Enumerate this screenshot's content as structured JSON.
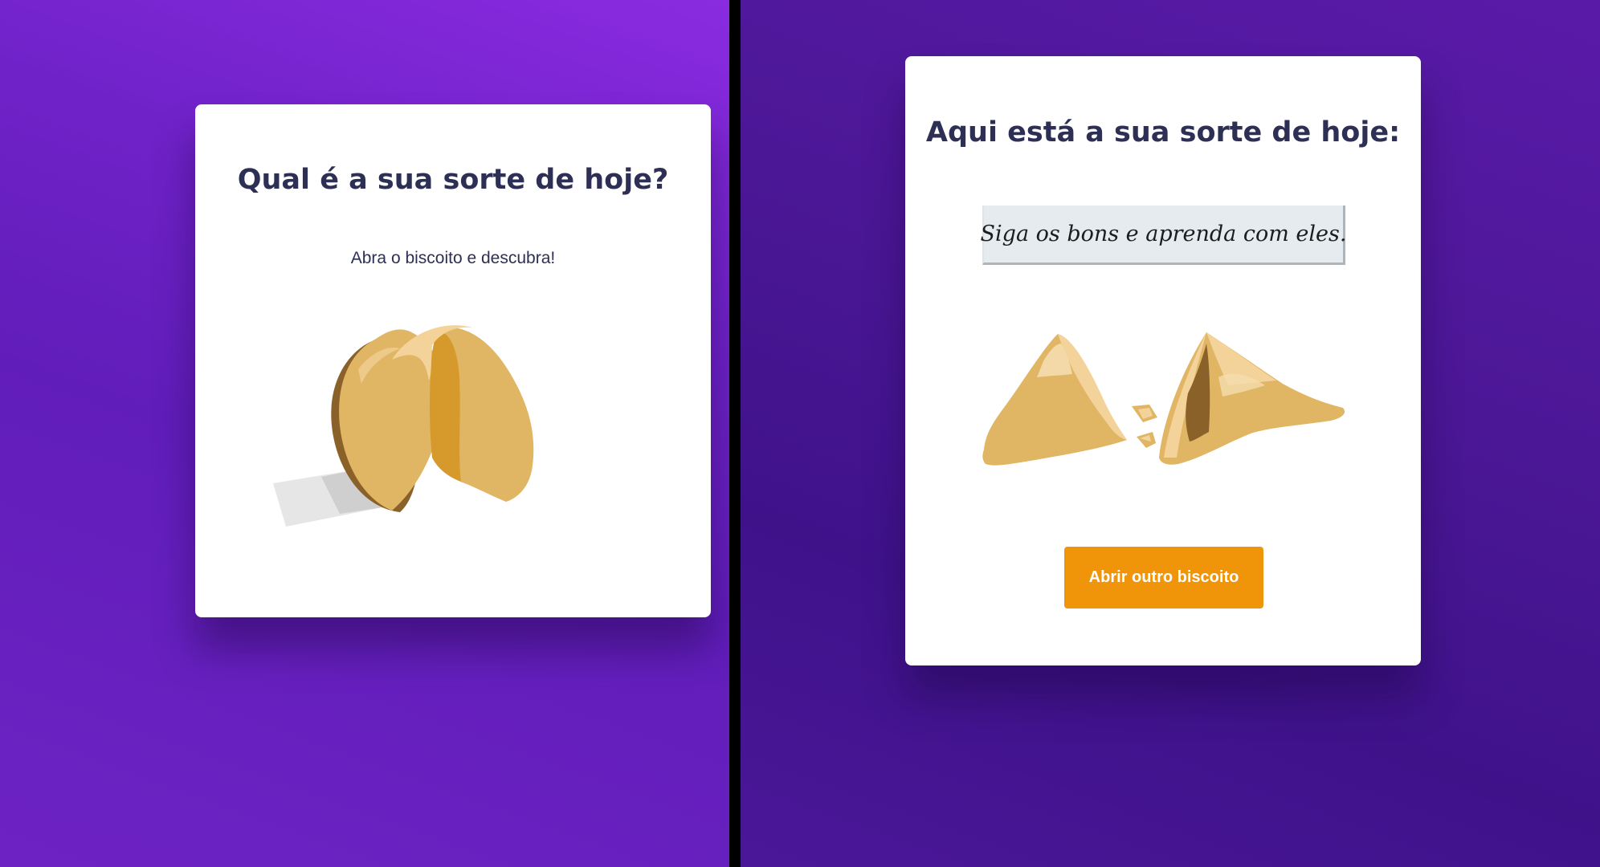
{
  "colors": {
    "title": "#2d2f55",
    "button_background": "#f0950a",
    "button_text": "#ffffff",
    "cookie_main": "#e0b564",
    "cookie_shadow": "#8a6128",
    "cookie_fold": "#d69a2c",
    "cookie_highlight": "#f3d39a",
    "slip_background": "#e5ebee"
  },
  "left_screen": {
    "title": "Qual é a sua sorte de hoje?",
    "subtitle": "Abra o biscoito e descubra!",
    "illustration": "fortune-cookie-closed-icon"
  },
  "right_screen": {
    "title": "Aqui está a sua sorte de hoje:",
    "fortune": "Siga os bons e aprenda com eles.",
    "illustration": "fortune-cookie-broken-icon",
    "button_label": "Abrir outro biscoito"
  }
}
